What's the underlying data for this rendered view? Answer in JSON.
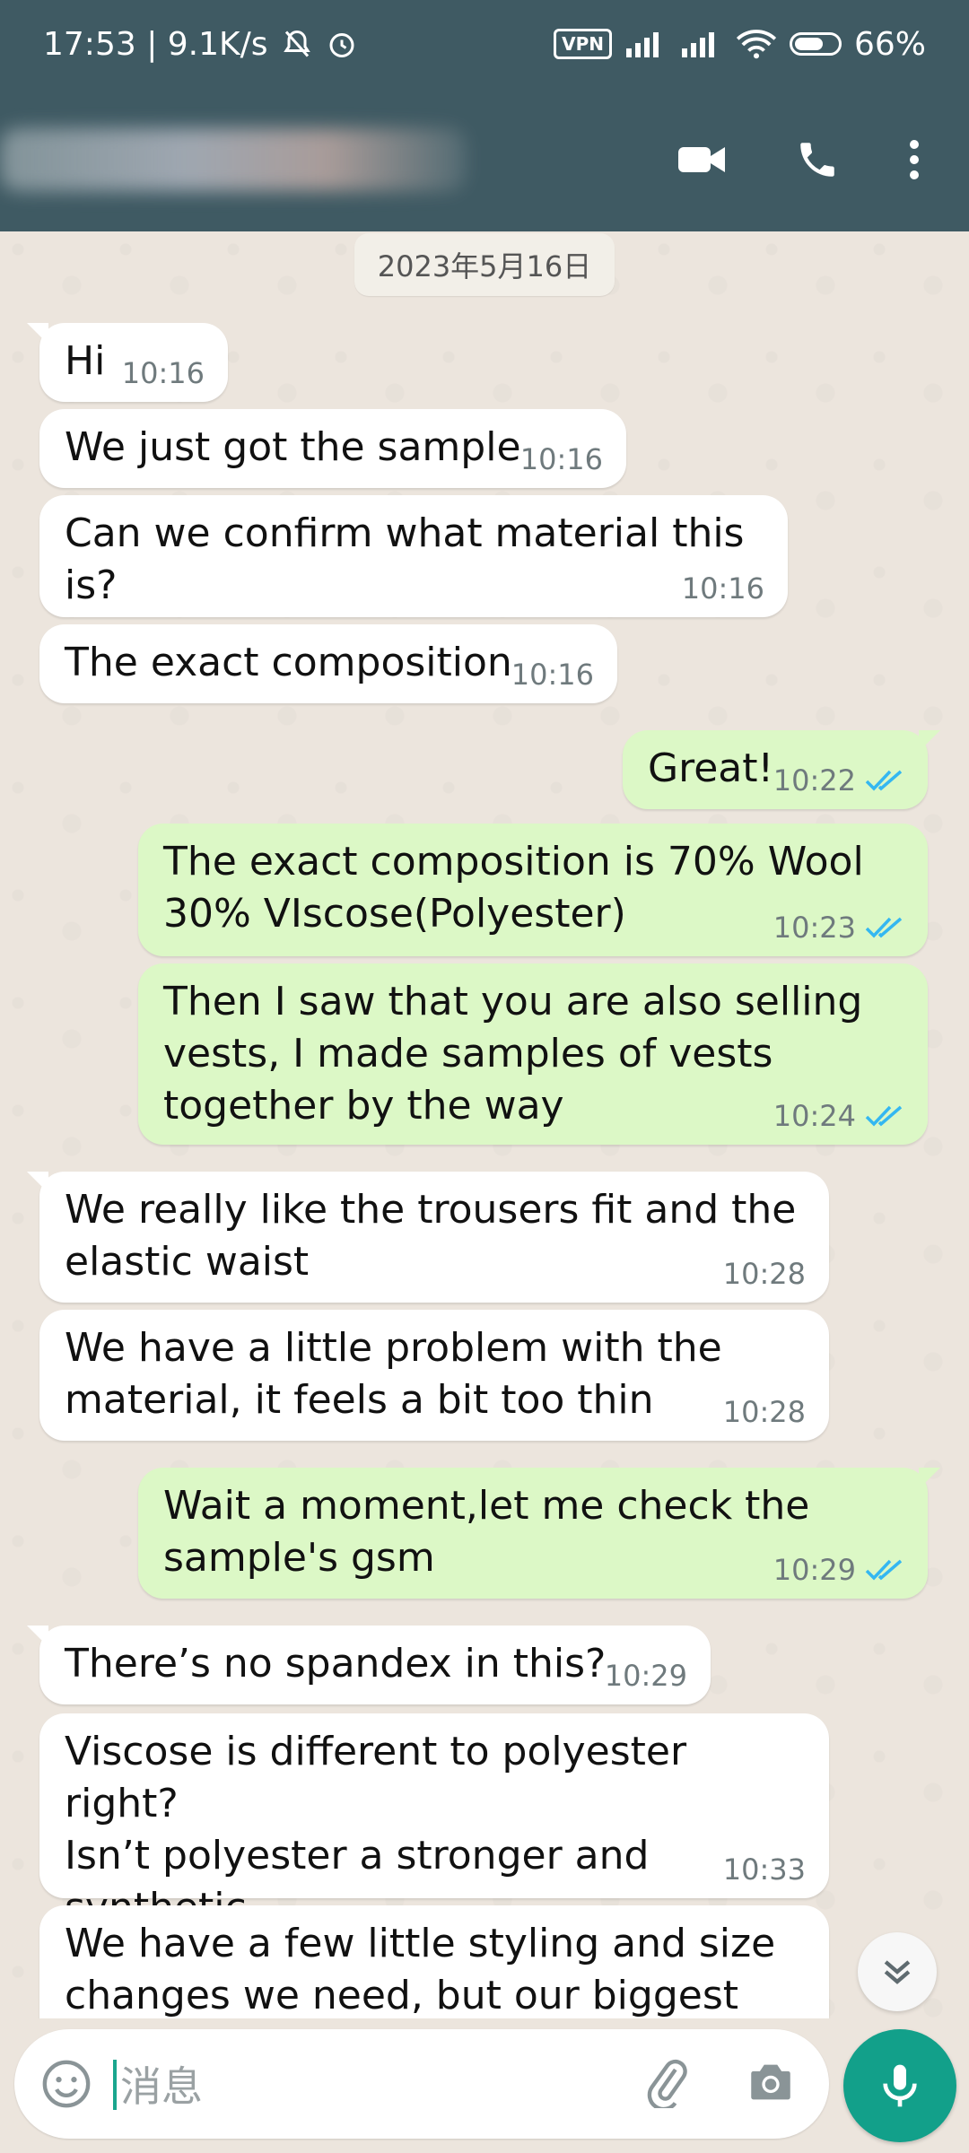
{
  "status_bar": {
    "time_speed": "17:53 | 9.1K/s",
    "vpn_label": "VPN",
    "battery": "66%"
  },
  "header": {
    "contact_name_visible": false,
    "video_call_icon": "video-camera-icon",
    "voice_call_icon": "phone-icon",
    "more_icon": "more-vert-icon"
  },
  "chat": {
    "date_separator": "2023年5月16日",
    "messages": [
      {
        "direction": "in",
        "text": "Hi",
        "time": "10:16"
      },
      {
        "direction": "in",
        "text": "We just got the sample",
        "time": "10:16"
      },
      {
        "direction": "in",
        "text": "Can we confirm what material this is?",
        "time": "10:16"
      },
      {
        "direction": "in",
        "text": "The exact composition",
        "time": "10:16"
      },
      {
        "direction": "out",
        "text": "Great!",
        "time": "10:22",
        "status": "read"
      },
      {
        "direction": "out",
        "text": "The exact composition is 70% Wool\n30% VIscose(Polyester)",
        "time": "10:23",
        "status": "read"
      },
      {
        "direction": "out",
        "text": "Then I saw that you are also selling\nvests, I made samples of vests\ntogether by the way",
        "time": "10:24",
        "status": "read"
      },
      {
        "direction": "in",
        "text": "We really like the trousers fit and the\nelastic waist",
        "time": "10:28"
      },
      {
        "direction": "in",
        "text": "We have a little problem with the\nmaterial, it feels a bit too thin",
        "time": "10:28"
      },
      {
        "direction": "out",
        "text": "Wait a moment,let me check the\nsample's gsm",
        "time": "10:29",
        "status": "read"
      },
      {
        "direction": "in",
        "text": "There’s no spandex in this?",
        "time": "10:29"
      },
      {
        "direction": "in",
        "text": "Viscose is different to polyester right?\nIsn’t polyester a stronger and synthetic\nmaterial?",
        "time": "10:33"
      },
      {
        "direction": "in",
        "text": "We have a few little styling and size\nchanges we need, but our biggest",
        "time": ""
      }
    ]
  },
  "composer": {
    "placeholder": "消息"
  },
  "colors": {
    "header_bg": "#3f5a63",
    "incoming_bubble": "#ffffff",
    "outgoing_bubble": "#dcf8c6",
    "read_ticks": "#34b7f1",
    "mic_button": "#12a08a"
  }
}
